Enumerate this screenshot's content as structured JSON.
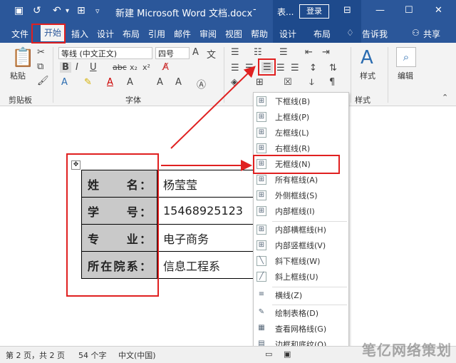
{
  "window": {
    "title": "新建 Microsoft Word 文档.docx",
    "separator": "-",
    "context_header": "表...",
    "login_label": "登录",
    "quick_access": [
      "save-icon",
      "undo-icon",
      "redo-icon",
      "customize-icon"
    ]
  },
  "tabs": [
    "文件",
    "开始",
    "插入",
    "设计",
    "布局",
    "引用",
    "邮件",
    "审阅",
    "视图",
    "帮助"
  ],
  "context_tabs": [
    "设计",
    "布局"
  ],
  "tell_me": "告诉我",
  "share": "共享",
  "ribbon": {
    "clipboard": {
      "paste": "粘贴",
      "group": "剪贴板"
    },
    "font": {
      "font_name": "等线 (中文正文)",
      "font_size": "四号",
      "group": "字体",
      "bold": "B",
      "italic": "I",
      "underline": "U",
      "strike": "abc",
      "sub": "x₂",
      "sup": "x²"
    },
    "styles": {
      "label": "样式",
      "group": "样式"
    },
    "editing": {
      "label": "编辑"
    }
  },
  "table": {
    "rows": [
      {
        "label": "姓　　名：",
        "value": "杨莹莹"
      },
      {
        "label": "学　　号：",
        "value": "15468925123"
      },
      {
        "label": "专　　业：",
        "value": "电子商务"
      },
      {
        "label": "所在院系：",
        "value": "信息工程系"
      }
    ]
  },
  "border_menu": {
    "items": [
      "下框线(B)",
      "上框线(P)",
      "左框线(L)",
      "右框线(R)",
      "无框线(N)",
      "所有框线(A)",
      "外侧框线(S)",
      "内部框线(I)",
      "内部横框线(H)",
      "内部竖框线(V)",
      "斜下框线(W)",
      "斜上框线(U)",
      "横线(Z)",
      "绘制表格(D)",
      "查看网格线(G)",
      "边框和底纹(O)..."
    ]
  },
  "status": {
    "page": "第 2 页，共 2 页",
    "words": "54 个字",
    "language": "中文(中国)"
  },
  "watermark": "笔亿网络策划",
  "colors": {
    "accent": "#2b579a",
    "annotation": "#e02020"
  }
}
